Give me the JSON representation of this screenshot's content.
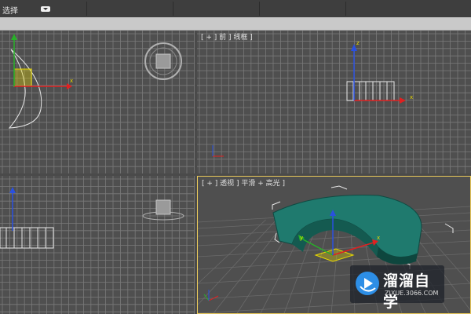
{
  "toolbar": {
    "selection_mode": "选择",
    "dropdown_icon": "dropdown-arrow-icon"
  },
  "viewports": {
    "top_left": {
      "label": ""
    },
    "top_right": {
      "label": "[ + ] 前 ] 线框 ]"
    },
    "bottom_left": {
      "label": ""
    },
    "perspective": {
      "label": "[ + ] 透视 ] 平滑 + 高光 ]"
    }
  },
  "axes": {
    "x": "x",
    "y": "y",
    "z": "z"
  },
  "colors": {
    "viewport_bg": "#4f4f4f",
    "grid_line": "#7a7a7a",
    "active_border": "#e8c85a",
    "object_teal": "#1f7a6e",
    "gizmo_x": "#e02020",
    "gizmo_y": "#28b028",
    "gizmo_z": "#2a50e0",
    "gizmo_plane": "#e8d800"
  },
  "watermark": {
    "title": "溜溜自学",
    "url": "ZIXUE.3066.COM",
    "icon": "play-logo-icon"
  }
}
